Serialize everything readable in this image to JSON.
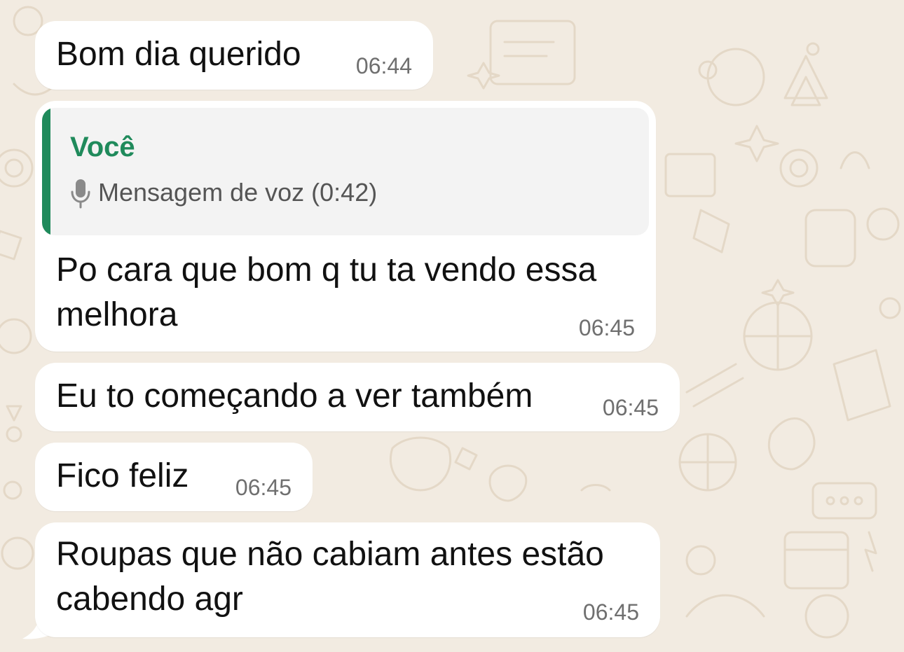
{
  "chat": {
    "messages": [
      {
        "text": "Bom dia querido",
        "time": "06:44"
      },
      {
        "reply": {
          "author": "Você",
          "voice": "Mensagem de voz (0:42)",
          "icon": "mic-icon"
        },
        "lines": [
          "Po cara que bom q tu ta vendo essa",
          "melhora"
        ],
        "time": "06:45"
      },
      {
        "text": "Eu to começando a ver também",
        "time": "06:45"
      },
      {
        "text": "Fico feliz",
        "time": "06:45"
      },
      {
        "lines": [
          "Roupas que não cabiam antes estão",
          "cabendo agr"
        ],
        "time": "06:45"
      }
    ]
  },
  "colors": {
    "background": "#f2ebe1",
    "bubble": "#ffffff",
    "reply_accent": "#1f8a5b",
    "timestamp": "#6f6f6f"
  }
}
